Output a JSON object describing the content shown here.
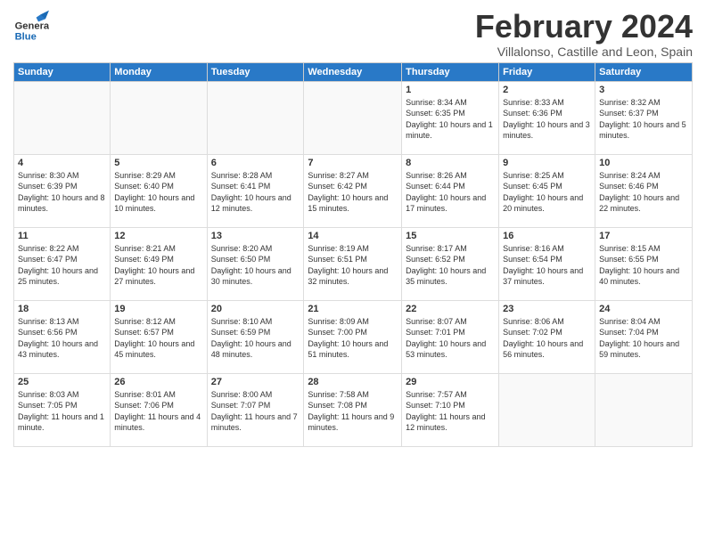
{
  "header": {
    "logo_general": "General",
    "logo_blue": "Blue",
    "month_title": "February 2024",
    "subtitle": "Villalonso, Castille and Leon, Spain"
  },
  "weekdays": [
    "Sunday",
    "Monday",
    "Tuesday",
    "Wednesday",
    "Thursday",
    "Friday",
    "Saturday"
  ],
  "weeks": [
    [
      {
        "day": "",
        "info": ""
      },
      {
        "day": "",
        "info": ""
      },
      {
        "day": "",
        "info": ""
      },
      {
        "day": "",
        "info": ""
      },
      {
        "day": "1",
        "info": "Sunrise: 8:34 AM\nSunset: 6:35 PM\nDaylight: 10 hours\nand 1 minute."
      },
      {
        "day": "2",
        "info": "Sunrise: 8:33 AM\nSunset: 6:36 PM\nDaylight: 10 hours\nand 3 minutes."
      },
      {
        "day": "3",
        "info": "Sunrise: 8:32 AM\nSunset: 6:37 PM\nDaylight: 10 hours\nand 5 minutes."
      }
    ],
    [
      {
        "day": "4",
        "info": "Sunrise: 8:30 AM\nSunset: 6:39 PM\nDaylight: 10 hours\nand 8 minutes."
      },
      {
        "day": "5",
        "info": "Sunrise: 8:29 AM\nSunset: 6:40 PM\nDaylight: 10 hours\nand 10 minutes."
      },
      {
        "day": "6",
        "info": "Sunrise: 8:28 AM\nSunset: 6:41 PM\nDaylight: 10 hours\nand 12 minutes."
      },
      {
        "day": "7",
        "info": "Sunrise: 8:27 AM\nSunset: 6:42 PM\nDaylight: 10 hours\nand 15 minutes."
      },
      {
        "day": "8",
        "info": "Sunrise: 8:26 AM\nSunset: 6:44 PM\nDaylight: 10 hours\nand 17 minutes."
      },
      {
        "day": "9",
        "info": "Sunrise: 8:25 AM\nSunset: 6:45 PM\nDaylight: 10 hours\nand 20 minutes."
      },
      {
        "day": "10",
        "info": "Sunrise: 8:24 AM\nSunset: 6:46 PM\nDaylight: 10 hours\nand 22 minutes."
      }
    ],
    [
      {
        "day": "11",
        "info": "Sunrise: 8:22 AM\nSunset: 6:47 PM\nDaylight: 10 hours\nand 25 minutes."
      },
      {
        "day": "12",
        "info": "Sunrise: 8:21 AM\nSunset: 6:49 PM\nDaylight: 10 hours\nand 27 minutes."
      },
      {
        "day": "13",
        "info": "Sunrise: 8:20 AM\nSunset: 6:50 PM\nDaylight: 10 hours\nand 30 minutes."
      },
      {
        "day": "14",
        "info": "Sunrise: 8:19 AM\nSunset: 6:51 PM\nDaylight: 10 hours\nand 32 minutes."
      },
      {
        "day": "15",
        "info": "Sunrise: 8:17 AM\nSunset: 6:52 PM\nDaylight: 10 hours\nand 35 minutes."
      },
      {
        "day": "16",
        "info": "Sunrise: 8:16 AM\nSunset: 6:54 PM\nDaylight: 10 hours\nand 37 minutes."
      },
      {
        "day": "17",
        "info": "Sunrise: 8:15 AM\nSunset: 6:55 PM\nDaylight: 10 hours\nand 40 minutes."
      }
    ],
    [
      {
        "day": "18",
        "info": "Sunrise: 8:13 AM\nSunset: 6:56 PM\nDaylight: 10 hours\nand 43 minutes."
      },
      {
        "day": "19",
        "info": "Sunrise: 8:12 AM\nSunset: 6:57 PM\nDaylight: 10 hours\nand 45 minutes."
      },
      {
        "day": "20",
        "info": "Sunrise: 8:10 AM\nSunset: 6:59 PM\nDaylight: 10 hours\nand 48 minutes."
      },
      {
        "day": "21",
        "info": "Sunrise: 8:09 AM\nSunset: 7:00 PM\nDaylight: 10 hours\nand 51 minutes."
      },
      {
        "day": "22",
        "info": "Sunrise: 8:07 AM\nSunset: 7:01 PM\nDaylight: 10 hours\nand 53 minutes."
      },
      {
        "day": "23",
        "info": "Sunrise: 8:06 AM\nSunset: 7:02 PM\nDaylight: 10 hours\nand 56 minutes."
      },
      {
        "day": "24",
        "info": "Sunrise: 8:04 AM\nSunset: 7:04 PM\nDaylight: 10 hours\nand 59 minutes."
      }
    ],
    [
      {
        "day": "25",
        "info": "Sunrise: 8:03 AM\nSunset: 7:05 PM\nDaylight: 11 hours\nand 1 minute."
      },
      {
        "day": "26",
        "info": "Sunrise: 8:01 AM\nSunset: 7:06 PM\nDaylight: 11 hours\nand 4 minutes."
      },
      {
        "day": "27",
        "info": "Sunrise: 8:00 AM\nSunset: 7:07 PM\nDaylight: 11 hours\nand 7 minutes."
      },
      {
        "day": "28",
        "info": "Sunrise: 7:58 AM\nSunset: 7:08 PM\nDaylight: 11 hours\nand 9 minutes."
      },
      {
        "day": "29",
        "info": "Sunrise: 7:57 AM\nSunset: 7:10 PM\nDaylight: 11 hours\nand 12 minutes."
      },
      {
        "day": "",
        "info": ""
      },
      {
        "day": "",
        "info": ""
      }
    ]
  ]
}
